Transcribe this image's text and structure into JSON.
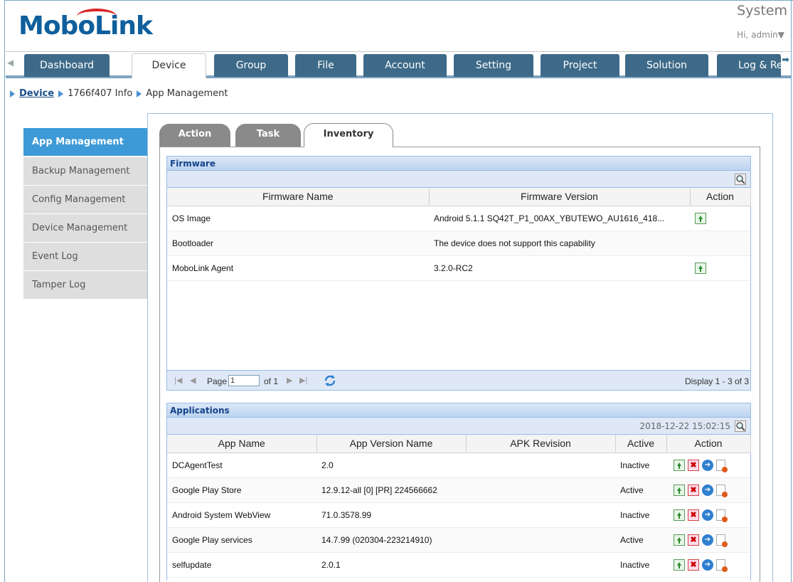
{
  "header": {
    "logo_text": "MoboLink",
    "system_title": "System",
    "user_menu": "Hi, admin▼"
  },
  "nav": {
    "tabs": [
      {
        "label": "Dashboard"
      },
      {
        "label": "Device",
        "active": true
      },
      {
        "label": "Group"
      },
      {
        "label": "File"
      },
      {
        "label": "Account"
      },
      {
        "label": "Setting"
      },
      {
        "label": "Project"
      },
      {
        "label": "Solution"
      },
      {
        "label": "Log & Re"
      }
    ]
  },
  "breadcrumb": {
    "device": "Device",
    "info": "1766f407 Info",
    "page": "App Management"
  },
  "side_menu": {
    "items": [
      {
        "label": "App Management",
        "active": true
      },
      {
        "label": "Backup Management"
      },
      {
        "label": "Config Management"
      },
      {
        "label": "Device Management"
      },
      {
        "label": "Event Log"
      },
      {
        "label": "Tamper Log"
      }
    ]
  },
  "subtabs": {
    "action": "Action",
    "task": "Task",
    "inventory": "Inventory"
  },
  "firmware": {
    "title": "Firmware",
    "columns": [
      "Firmware Name",
      "Firmware Version",
      "Action"
    ],
    "rows": [
      {
        "name": "OS Image",
        "version": "Android 5.1.1 SQ42T_P1_00AX_YBUTEWO_AU1616_418...",
        "upgrade": true
      },
      {
        "name": "Bootloader",
        "version": "The device does not support this capability",
        "upgrade": false
      },
      {
        "name": "MoboLink Agent",
        "version": "3.2.0-RC2",
        "upgrade": true
      }
    ],
    "paging": {
      "page_label": "Page",
      "page_value": "1",
      "of_label": "of 1",
      "display": "Display 1 - 3 of 3"
    }
  },
  "applications": {
    "title": "Applications",
    "timestamp": "2018-12-22 15:02:15",
    "columns": [
      "App Name",
      "App Version Name",
      "APK Revision",
      "Active",
      "Action"
    ],
    "rows": [
      {
        "name": "DCAgentTest",
        "version": "2.0",
        "revision": "",
        "active": "Inactive"
      },
      {
        "name": "Google Play Store",
        "version": "12.9.12-all [0] [PR] 224566662",
        "revision": "",
        "active": "Active"
      },
      {
        "name": "Android System WebView",
        "version": "71.0.3578.99",
        "revision": "",
        "active": "Inactive"
      },
      {
        "name": "Google Play services",
        "version": "14.7.99 (020304-223214910)",
        "revision": "",
        "active": "Active"
      },
      {
        "name": "selfupdate",
        "version": "2.0.1",
        "revision": "",
        "active": "Inactive"
      }
    ]
  },
  "colors": {
    "nav_tab": "#3d6a88",
    "side_active": "#3e9ad6",
    "panel_header": "#15428b",
    "brand_red": "#d9282b"
  }
}
